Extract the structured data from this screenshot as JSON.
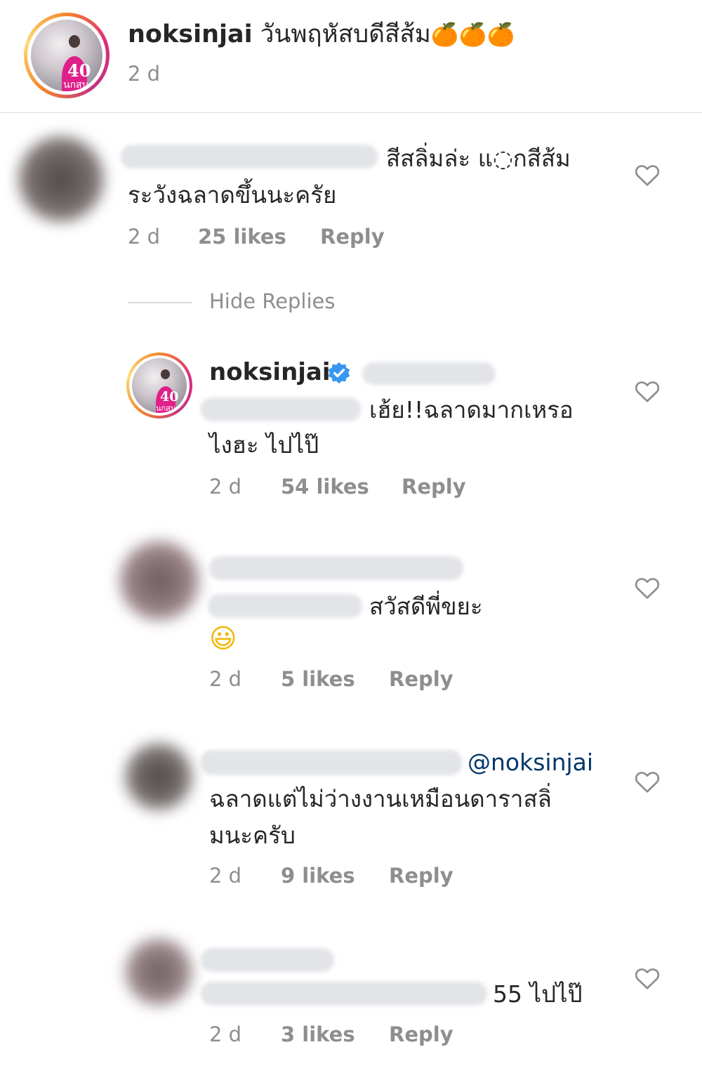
{
  "post": {
    "username": "noksinjai",
    "caption": "วันพฤหัสบดีสีส้ม",
    "emoji": "🍊🍊🍊",
    "time": "2 d",
    "avatar_text": "40",
    "avatar_sub": "นกสน"
  },
  "comments": [
    {
      "text_line1": "สีสลิ่มล่ะ แ◌กสีส้ม",
      "text_line2": "ระวังฉลาดขึ้นนะครัย",
      "time": "2 d",
      "likes": "25 likes",
      "reply": "Reply",
      "hide_replies": "Hide Replies"
    }
  ],
  "replies": [
    {
      "username": "noksinjai",
      "verified": true,
      "text_line1": "เฮ้ย!!ฉลาดมากเหรอ",
      "text_line2": "ไงฮะ ไปไป๊",
      "time": "2 d",
      "likes": "54 likes",
      "reply": "Reply"
    },
    {
      "text_line1": "สวัสดีพี่ขยะ",
      "emoji": "😃",
      "time": "2 d",
      "likes": "5 likes",
      "reply": "Reply"
    },
    {
      "mention": "@noksinjai",
      "text_line1": "ฉลาดแต่ไม่ว่างงานเหมือนดาราสลิ่",
      "text_line2": "มนะครับ",
      "time": "2 d",
      "likes": "9 likes",
      "reply": "Reply"
    },
    {
      "text_line1": "55 ไปไป๊",
      "time": "2 d",
      "likes": "3 likes",
      "reply": "Reply"
    }
  ],
  "colors": {
    "text": "#262626",
    "meta": "#8e8e8e",
    "verified": "#3897f0",
    "mention": "#00376b",
    "divider": "#dbdbdb"
  }
}
